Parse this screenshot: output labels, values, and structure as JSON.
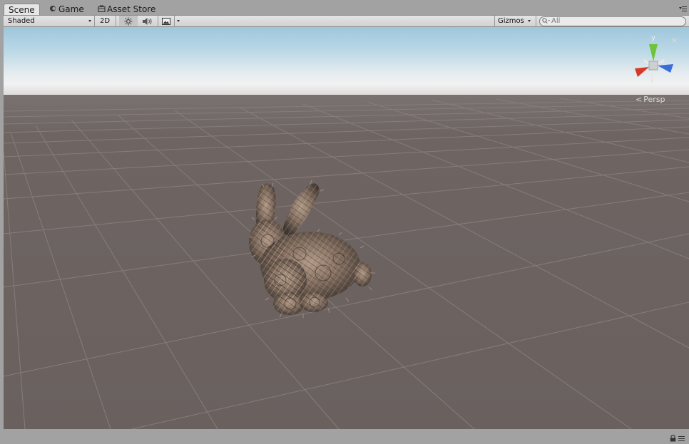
{
  "tabs": [
    {
      "label": "Scene",
      "icon": "",
      "active": true
    },
    {
      "label": "Game",
      "icon": "game-icon",
      "active": false
    },
    {
      "label": "Asset Store",
      "icon": "store-icon",
      "active": false
    }
  ],
  "toolbar": {
    "shading_mode": "Shaded",
    "mode_2d_label": "2D",
    "lighting_icon": "sun-icon",
    "audio_icon": "speaker-icon",
    "effects_icon": "image-icon",
    "gizmos_label": "Gizmos",
    "search_placeholder": "All"
  },
  "viewport": {
    "projection_label": "Persp",
    "gizmo_axis_label": "y",
    "sky_color": "#b8d7e7",
    "ground_color": "#6d6462",
    "grid_color": "#857c7a",
    "model": "fur-bunny",
    "model_color": "#a08878"
  }
}
